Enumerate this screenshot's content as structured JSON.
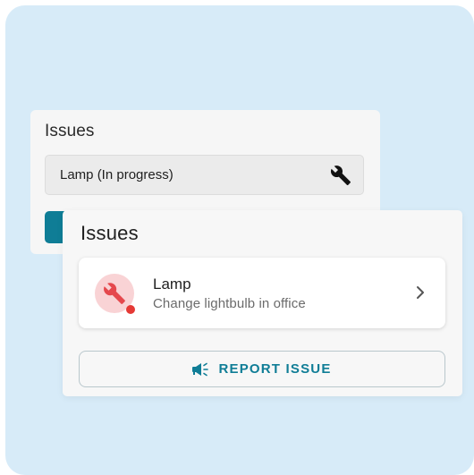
{
  "back_card": {
    "title": "Issues",
    "field_value": "Lamp (In progress)",
    "field_icon": "wrench-icon"
  },
  "front_card": {
    "title": "Issues",
    "issue": {
      "name": "Lamp",
      "description": "Change lightbulb in office",
      "icon": "wrench-icon",
      "status_color": "#e53935",
      "icon_bg": "#f9d3d5",
      "icon_color": "#e5484d"
    },
    "report_button": {
      "label": "REPORT ISSUE",
      "icon": "megaphone-icon"
    }
  },
  "colors": {
    "background": "#d7ebf8",
    "accent": "#0f7d96"
  }
}
